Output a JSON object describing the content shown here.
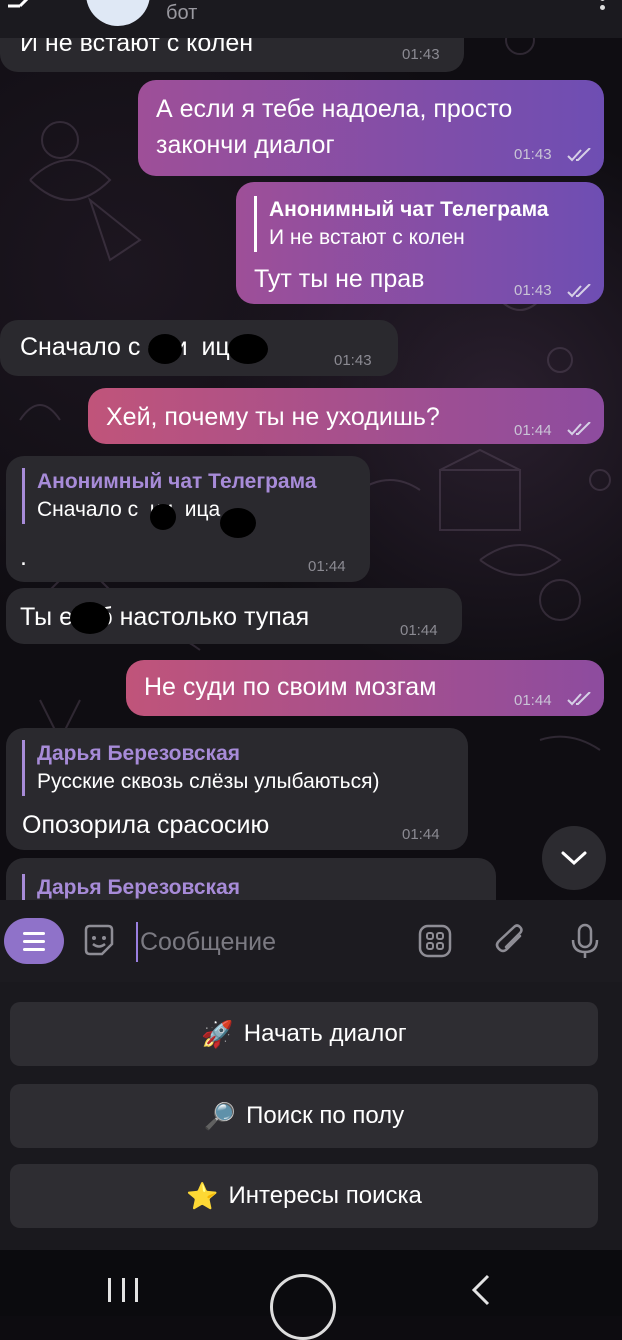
{
  "header": {
    "subtitle": "бот"
  },
  "messages": {
    "m1": {
      "text": "И не встают с колен",
      "time": "01:43"
    },
    "m2": {
      "line1": "А если я тебе надоела, просто",
      "line2": "закончи диалог",
      "time": "01:43"
    },
    "m3": {
      "reply_name": "Анонимный чат Телеграма",
      "reply_text": "И не встают с колен",
      "text": "Тут ты не прав",
      "time": "01:43"
    },
    "m4": {
      "text": "Сначало с сни  ица",
      "time": "01:43"
    },
    "m5": {
      "text": "Хей, почему ты не уходишь?",
      "time": "01:44"
    },
    "m6": {
      "reply_name": "Анонимный чат Телеграма",
      "reply_text": "Сначало с  ни  ица",
      "text": ".",
      "time": "01:44"
    },
    "m7": {
      "text": "Ты е  тб настолько тупая",
      "time": "01:44"
    },
    "m8": {
      "text": "Не суди по своим мозгам",
      "time": "01:44"
    },
    "m9": {
      "reply_name": "Дарья Березовская",
      "reply_text": "Русские сквозь слёзы улыбаються)",
      "text": "Опозорила срасосию",
      "time": "01:44"
    },
    "m10": {
      "reply_name": "Дарья Березовская"
    }
  },
  "input": {
    "placeholder": "Сообщение"
  },
  "keyboard": {
    "buttons": [
      {
        "emoji": "🚀",
        "label": "Начать диалог"
      },
      {
        "emoji": "🔎",
        "label": "Поиск по полу"
      },
      {
        "emoji": "⭐",
        "label": "Интересы поиска"
      }
    ]
  },
  "icons": {
    "menu": "menu-icon",
    "sticker": "sticker-icon",
    "bot_commands": "bot-keyboard-icon",
    "attach": "paperclip-icon",
    "mic": "microphone-icon",
    "scroll": "chevron-down-icon"
  },
  "colors": {
    "accent": "#8f72c9",
    "reply_name_in": "#a78bd8",
    "bubble_in": "#2a292e",
    "bubble_out_start": "#a8558d",
    "bubble_out_end": "#7a4fb3"
  }
}
